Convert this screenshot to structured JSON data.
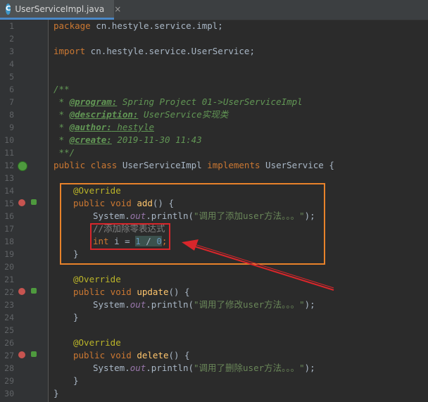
{
  "tab": {
    "title": "UserServiceImpl.java",
    "icon": "java-class-icon",
    "close": "×",
    "accent": "#4a88c7"
  },
  "line_numbers": [
    "1",
    "2",
    "3",
    "4",
    "5",
    "6",
    "7",
    "8",
    "9",
    "10",
    "11",
    "12",
    "13",
    "14",
    "15",
    "16",
    "17",
    "18",
    "19",
    "20",
    "21",
    "22",
    "23",
    "24",
    "25",
    "26",
    "27",
    "28",
    "29",
    "30"
  ],
  "code": {
    "l1_kw": "package",
    "l1_rest": " cn.hestyle.service.impl;",
    "l3_kw": "import",
    "l3_rest": " cn.hestyle.service.UserService;",
    "l6": "/**",
    "l7_pre": " * ",
    "l7_tag": "@program:",
    "l7_text": " Spring Project 01->UserServiceImpl",
    "l8_pre": " * ",
    "l8_tag": "@description:",
    "l8_text": " UserService实现类",
    "l9_pre": " * ",
    "l9_tag": "@author:",
    "l9_text": " hestyle",
    "l10_pre": " * ",
    "l10_tag": "@create:",
    "l10_text": " 2019-11-30 11:43",
    "l11": " **/",
    "l12_kw": "public class",
    "l12_name": " UserServiceImpl ",
    "l12_kw2": "implements",
    "l12_rest": " UserService {",
    "annotation": "@Override",
    "public_void": "public void",
    "m1_name": "add",
    "m2_name": "update",
    "m3_name": "delete",
    "sig_tail": "() {",
    "sys": "System.",
    "out": "out",
    "println": ".println(",
    "s1": "\"调用了添加user方法。。。\"",
    "s2": "\"调用了修改user方法。。。\"",
    "s3": "\"调用了删除user方法。。。\"",
    "close_call": ");",
    "comment": "//添加除零表达式",
    "int_kw": "int",
    "var": " i = ",
    "n1": "1",
    "div": " / ",
    "n0": "0",
    "semi": ";",
    "rbrace": "}"
  },
  "annotation_colors": {
    "orange_box": "#e8822a",
    "red_box": "#d9262b",
    "arrow": "#d9262b"
  }
}
